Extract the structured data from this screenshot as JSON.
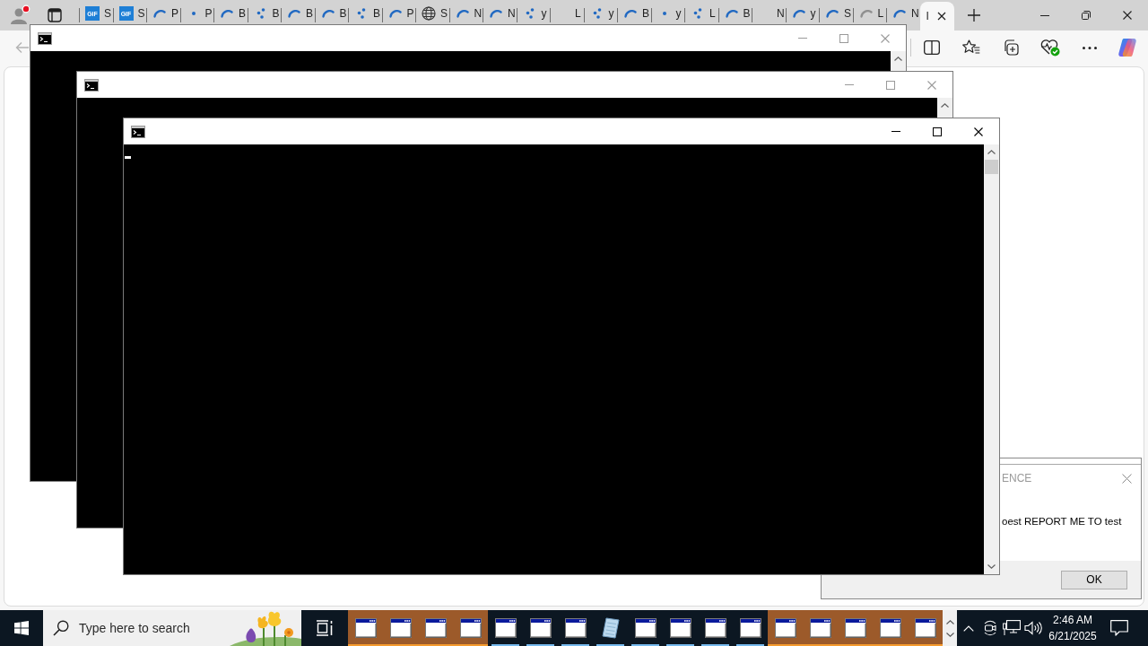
{
  "browser": {
    "tabs": [
      {
        "label": "S",
        "kind": "gif",
        "icon_text": "GIF",
        "selected": false
      },
      {
        "label": "S",
        "kind": "gif",
        "icon_text": "GIF",
        "selected": false
      },
      {
        "label": "P",
        "kind": "arc",
        "selected": false
      },
      {
        "label": "P",
        "kind": "dot",
        "selected": false
      },
      {
        "label": "B",
        "kind": "arc",
        "selected": false
      },
      {
        "label": "B",
        "kind": "dots",
        "selected": false
      },
      {
        "label": "B",
        "kind": "arc",
        "selected": false
      },
      {
        "label": "B",
        "kind": "arc",
        "selected": false
      },
      {
        "label": "B",
        "kind": "dots",
        "selected": false
      },
      {
        "label": "P",
        "kind": "arc",
        "selected": false
      },
      {
        "label": "S",
        "kind": "globe",
        "selected": false
      },
      {
        "label": "N",
        "kind": "arc",
        "selected": false
      },
      {
        "label": "N",
        "kind": "arc",
        "selected": false
      },
      {
        "label": "y",
        "kind": "dots",
        "selected": false
      },
      {
        "label": "L",
        "kind": "blank",
        "selected": false
      },
      {
        "label": "y",
        "kind": "dots",
        "selected": false
      },
      {
        "label": "B",
        "kind": "arc",
        "selected": false
      },
      {
        "label": "y",
        "kind": "dot",
        "selected": false
      },
      {
        "label": "L",
        "kind": "dots",
        "selected": false
      },
      {
        "label": "B",
        "kind": "arc",
        "selected": false
      },
      {
        "label": "N",
        "kind": "blank",
        "selected": false
      },
      {
        "label": "y",
        "kind": "arc",
        "selected": false
      },
      {
        "label": "S",
        "kind": "arc",
        "selected": false
      },
      {
        "label": "L",
        "kind": "faded",
        "selected": false
      },
      {
        "label": "N",
        "kind": "arc",
        "selected": false
      },
      {
        "label": "I",
        "kind": "blank",
        "selected": true
      }
    ]
  },
  "consoles": [
    {
      "active": false
    },
    {
      "active": false
    },
    {
      "active": true
    }
  ],
  "dialog": {
    "title": "ENCE",
    "message": "oest REPORT ME TO test",
    "button": "OK"
  },
  "taskbar": {
    "search": {
      "placeholder": "Type here to search"
    },
    "apps": [
      {
        "kind": "window",
        "flashing": true
      },
      {
        "kind": "window",
        "flashing": true
      },
      {
        "kind": "window",
        "flashing": true
      },
      {
        "kind": "window",
        "flashing": true
      },
      {
        "kind": "window",
        "flashing": false
      },
      {
        "kind": "window",
        "flashing": false
      },
      {
        "kind": "window",
        "flashing": false
      },
      {
        "kind": "notepad",
        "flashing": false
      },
      {
        "kind": "window",
        "flashing": false
      },
      {
        "kind": "window",
        "flashing": false
      },
      {
        "kind": "window",
        "flashing": false
      },
      {
        "kind": "window",
        "flashing": false
      },
      {
        "kind": "window",
        "flashing": true
      },
      {
        "kind": "window",
        "flashing": true
      },
      {
        "kind": "window",
        "flashing": true
      },
      {
        "kind": "window",
        "flashing": true
      },
      {
        "kind": "window",
        "flashing": true
      }
    ],
    "clock": {
      "time": "2:46 AM",
      "date": "6/21/2025"
    }
  }
}
